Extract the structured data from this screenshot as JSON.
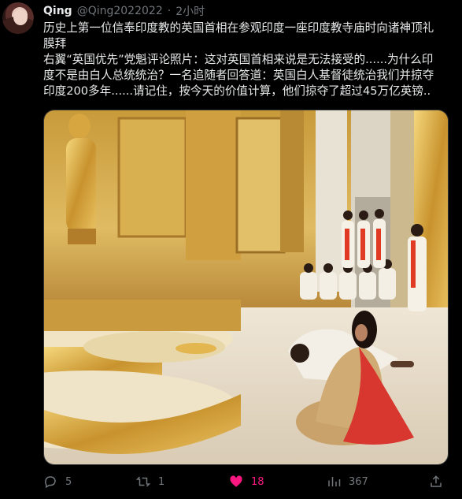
{
  "author": {
    "name": "Qing",
    "handle": "@Qing2022022",
    "separator": "·",
    "time": "2小时"
  },
  "tweet": {
    "line1": "历史上第一位信奉印度教的英国首相在参观印度一座印度教寺庙时向诸神顶礼",
    "line2": "膜拜",
    "line3": "右翼“英国优先”党魁评论照片：这对英国首相来说是无法接受的......为什么印",
    "line4": "度不是由白人总统统治？一名追随者回答道：英国白人基督徒统治我们并掠夺",
    "line5": "印度200多年......请记住，按今天的价值计算，他们掠夺了超过45万亿英镑.."
  },
  "actions": {
    "replies": "5",
    "retweets": "1",
    "likes": "18",
    "views": "367"
  },
  "icons": {
    "reply": "reply-icon",
    "retweet": "retweet-icon",
    "like": "heart-icon",
    "views": "views-icon",
    "share": "share-icon"
  },
  "colors": {
    "background": "#000000",
    "text": "#e7e9ea",
    "muted": "#71767b",
    "like": "#f91880",
    "border": "#2f3336"
  }
}
